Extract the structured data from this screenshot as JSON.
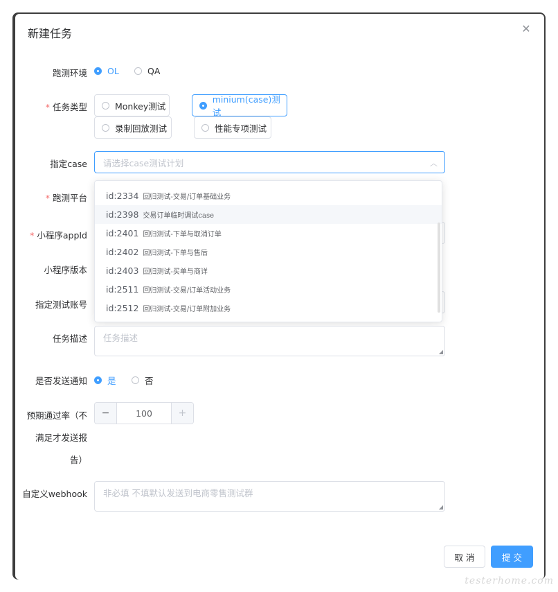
{
  "dialog": {
    "title": "新建任务",
    "close_icon": "close-icon"
  },
  "form": {
    "env": {
      "label": "跑测环境",
      "options": [
        "OL",
        "QA"
      ],
      "selected": "OL"
    },
    "task_type": {
      "label": "任务类型",
      "required": "*",
      "options": [
        "Monkey测试",
        "minium(case)测试",
        "录制回放测试",
        "性能专项测试"
      ],
      "selected": "minium(case)测试"
    },
    "case": {
      "label": "指定case",
      "placeholder": "请选择case测试计划",
      "arrow_icon": "chevron-up-icon",
      "dropdown": [
        {
          "id": "id:2334",
          "desc": "回归测试-交易/订单基础业务"
        },
        {
          "id": "id:2398",
          "desc": "交易订单临时调试case"
        },
        {
          "id": "id:2401",
          "desc": "回归测试-下单与取消订单"
        },
        {
          "id": "id:2402",
          "desc": "回归测试-下单与售后"
        },
        {
          "id": "id:2403",
          "desc": "回归测试-买单与商详"
        },
        {
          "id": "id:2511",
          "desc": "回归测试-交易/订单活动业务"
        },
        {
          "id": "id:2512",
          "desc": "回归测试-交易/订单附加业务"
        }
      ],
      "hovered": "id:2398"
    },
    "platform": {
      "label": "跑测平台",
      "required": "*"
    },
    "appid": {
      "label": "小程序appId",
      "required": "*"
    },
    "version": {
      "label": "小程序版本"
    },
    "account": {
      "label": "指定测试账号"
    },
    "description": {
      "label": "任务描述",
      "placeholder": "任务描述"
    },
    "notify": {
      "label": "是否发送通知",
      "options": [
        "是",
        "否"
      ],
      "selected": "是"
    },
    "pass_rate": {
      "label_line1": "预期通过率（不",
      "label_line2": "满足才发送报",
      "label_line3": "告）",
      "value": "100",
      "minus": "−",
      "plus": "+"
    },
    "webhook": {
      "label": "自定义webhook",
      "placeholder": "非必填 不填默认发送到电商零售测试群"
    }
  },
  "footer": {
    "cancel": "取 消",
    "submit": "提 交"
  },
  "watermark": "testerhome.com",
  "colors": {
    "primary": "#409eff",
    "required": "#f56c6c",
    "border": "#dcdfe6"
  }
}
